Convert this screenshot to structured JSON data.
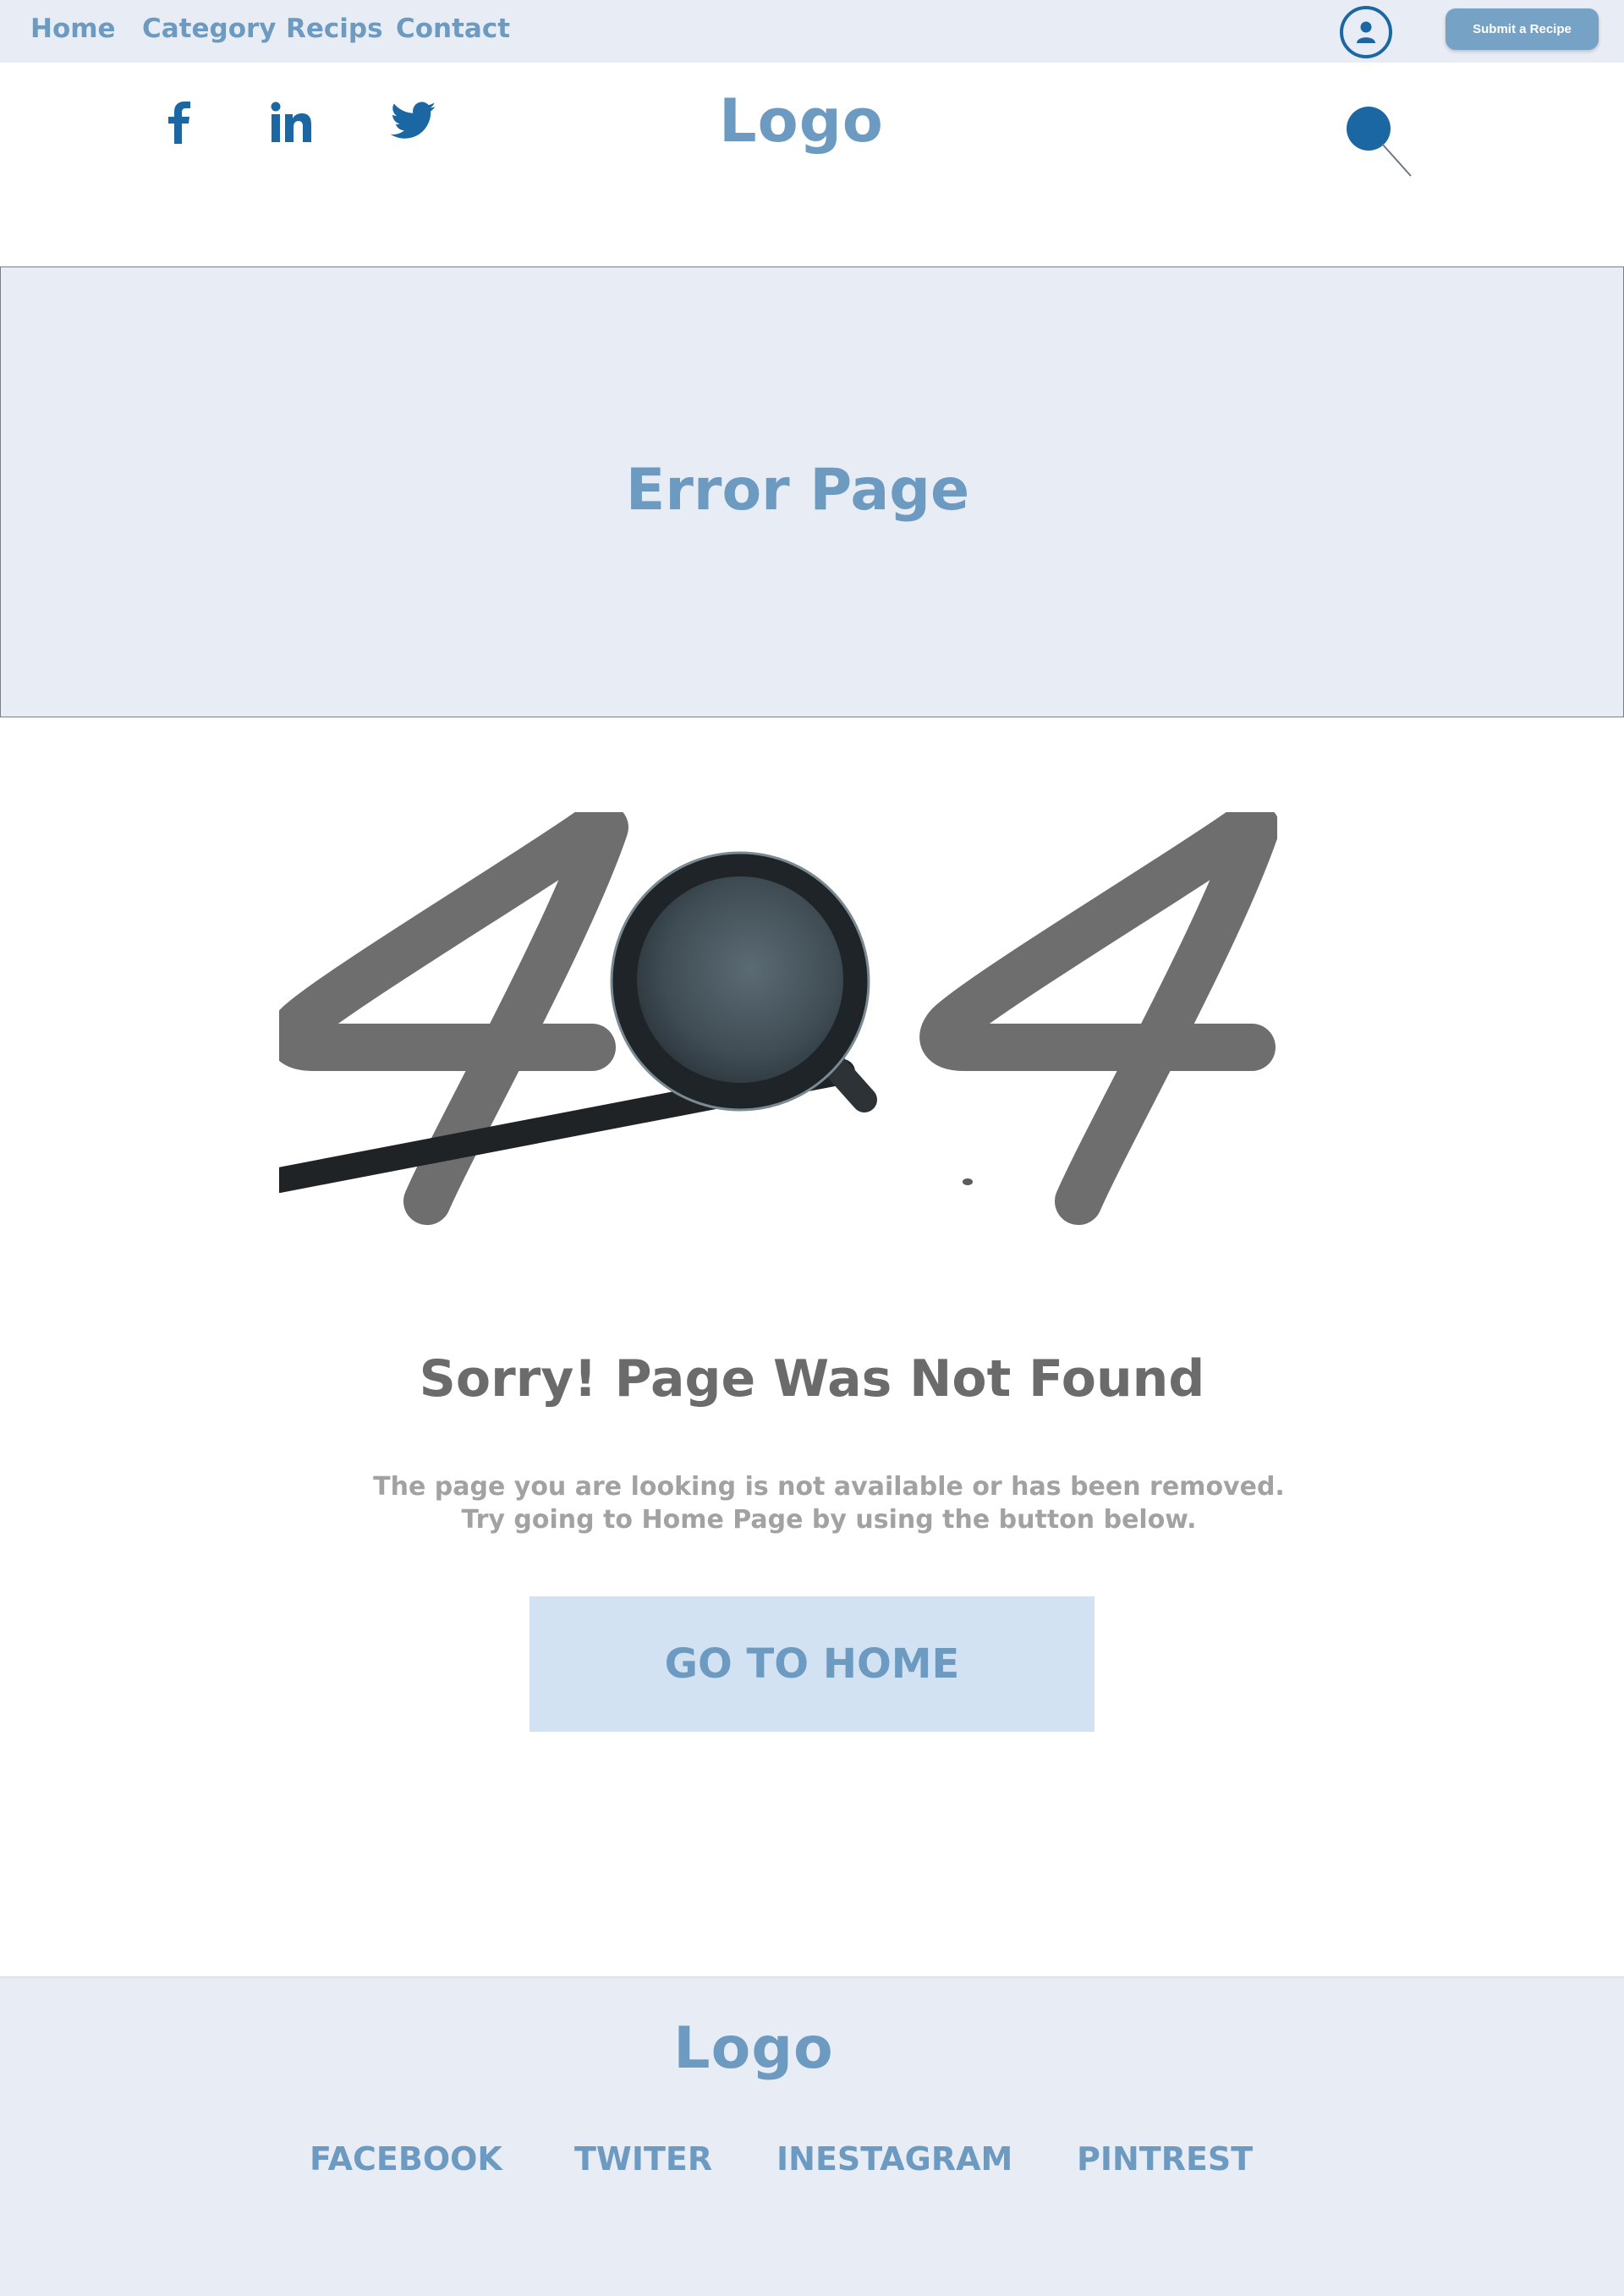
{
  "nav": {
    "items": [
      {
        "label": "Home"
      },
      {
        "label": "Category"
      },
      {
        "label": "Recips"
      },
      {
        "label": "Contact"
      }
    ],
    "user_icon": "user-icon",
    "submit_label": "Submit a Recipe"
  },
  "header": {
    "social_icons": [
      "facebook-icon",
      "linkedin-icon",
      "twitter-icon"
    ],
    "logo": "Logo",
    "search_icon": "search-icon"
  },
  "hero": {
    "title": "Error Page"
  },
  "error": {
    "code_graphic": "404",
    "heading": "Sorry! Page Was Not Found",
    "description": "The page you are looking is not available or has been removed. Try going to Home Page by using the button below.",
    "button_label": "GO TO HOME"
  },
  "footer": {
    "logo": "Logo",
    "links": [
      {
        "label": "FACEBOOK"
      },
      {
        "label": "TWITER"
      },
      {
        "label": "INESTAGRAM"
      },
      {
        "label": "PINTREST"
      }
    ]
  },
  "colors": {
    "accent": "#6d9ac0",
    "brand_dark": "#1b67a4",
    "band_background": "#e8edf5",
    "button_background": "#d2e2f2",
    "heading_gray": "#6b6b6b",
    "text_gray": "#a2a2a2"
  }
}
